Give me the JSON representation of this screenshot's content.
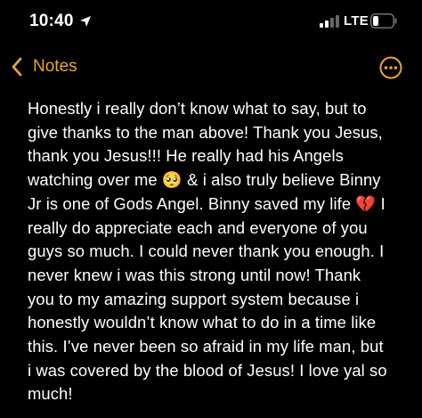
{
  "status_bar": {
    "time": "10:40",
    "network": "LTE",
    "location_icon": "location-arrow-icon",
    "signal_icon": "signal-bars-icon",
    "battery_icon": "battery-icon",
    "battery_level": 0.2
  },
  "nav": {
    "back_label": "Notes",
    "back_icon": "chevron-left-icon",
    "more_icon": "ellipsis-circle-icon",
    "accent": "#E4A827"
  },
  "note": {
    "text": "Honestly i really don’t know what to say, but to\ngive thanks to the man above! Thank you Jesus,\nthank you Jesus!!! He really had his Angels\nwatching over me 🥺 & i also truly believe Binny\nJr is one of Gods Angel. Binny saved my life 💔 I\nreally do appreciate each and everyone of you\nguys so much. I could never thank you enough. I\nnever knew i was this strong until now! Thank\nyou to my amazing support system because i\nhonestly wouldn’t know what to do in a time like\nthis. I’ve never been so afraid in my life man, but\ni was covered by the blood of Jesus! I love yal so\nmuch!"
  }
}
